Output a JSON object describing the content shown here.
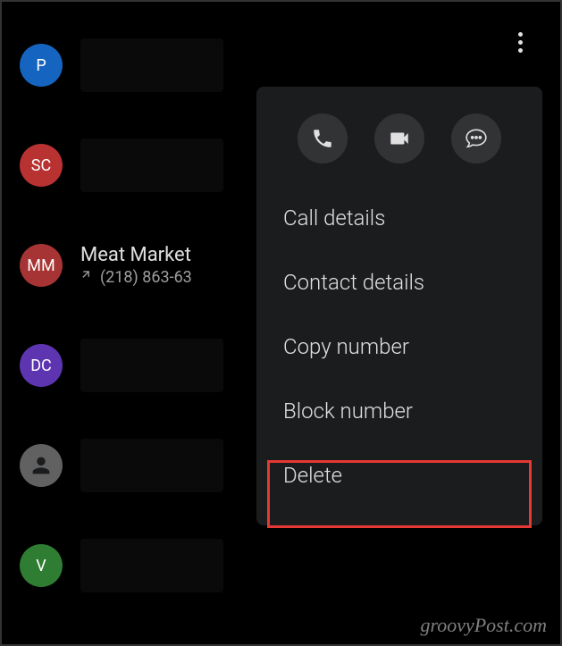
{
  "calls": [
    {
      "initials": "P",
      "color": "blue"
    },
    {
      "initials": "SC",
      "color": "red"
    },
    {
      "initials": "MM",
      "color": "darkred",
      "name": "Meat Market",
      "phone": "(218) 863-63"
    },
    {
      "initials": "DC",
      "color": "purple"
    },
    {
      "initials": "",
      "color": "gray",
      "isDefault": true
    },
    {
      "initials": "V",
      "color": "green"
    }
  ],
  "menu": {
    "call_details": "Call details",
    "contact_details": "Contact details",
    "copy_number": "Copy number",
    "block_number": "Block number",
    "delete": "Delete"
  },
  "watermark": "groovyPost.com"
}
